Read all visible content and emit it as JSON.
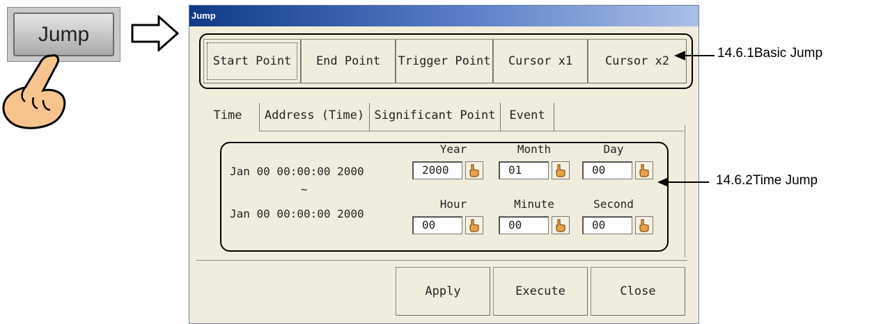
{
  "external": {
    "jump_button_label": "Jump"
  },
  "dialog": {
    "title": "Jump",
    "basic_jump_buttons": [
      "Start Point",
      "End Point",
      "Trigger Point",
      "Cursor x1",
      "Cursor x2"
    ],
    "tabs": [
      "Time",
      "Address (Time)",
      "Significant Point",
      "Event"
    ],
    "active_tab": "Time",
    "time_range": {
      "start": "Jan 00 00:00:00 2000",
      "separator": "~",
      "end": "Jan 00 00:00:00 2000"
    },
    "fields": {
      "year": {
        "label": "Year",
        "value": "2000"
      },
      "month": {
        "label": "Month",
        "value": "01"
      },
      "day": {
        "label": "Day",
        "value": "00"
      },
      "hour": {
        "label": "Hour",
        "value": "00"
      },
      "minute": {
        "label": "Minute",
        "value": "00"
      },
      "second": {
        "label": "Second",
        "value": "00"
      }
    },
    "footer_buttons": {
      "apply": "Apply",
      "execute": "Execute",
      "close": "Close"
    }
  },
  "annotations": {
    "basic_jump": "14.6.1Basic Jump",
    "time_jump": "14.6.2Time Jump"
  },
  "icons": {
    "hand": "pointing-hand-icon",
    "arrow": "outline-arrow-right-icon",
    "arrow_left": "arrow-left-icon"
  },
  "colors": {
    "dialog_bg": "#f0eddc",
    "titlebar": "#0f3a86",
    "hand_fill": "#f6c48c"
  }
}
